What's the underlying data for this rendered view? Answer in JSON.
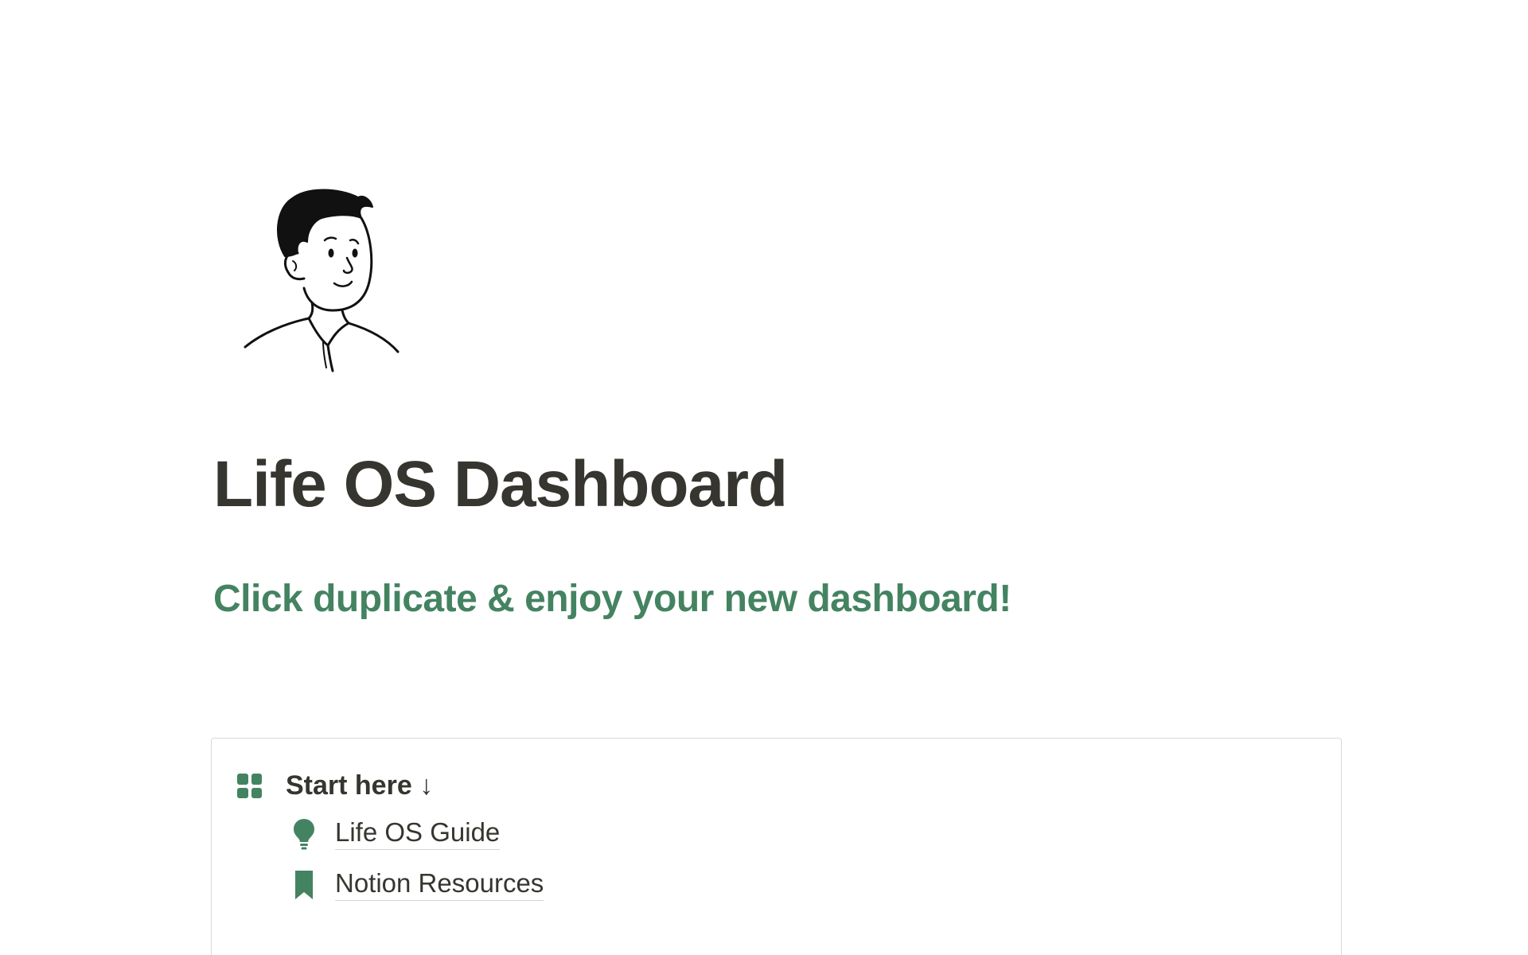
{
  "colors": {
    "accent": "#448361",
    "text": "#37352f"
  },
  "page": {
    "title": "Life OS Dashboard",
    "subtitle": "Click duplicate & enjoy your new dashboard!"
  },
  "card": {
    "header_icon": "grid-icon",
    "header_label": "Start here ↓",
    "links": [
      {
        "icon": "lightbulb-icon",
        "label": "Life OS Guide"
      },
      {
        "icon": "bookmark-icon",
        "label": "Notion Resources"
      }
    ]
  }
}
